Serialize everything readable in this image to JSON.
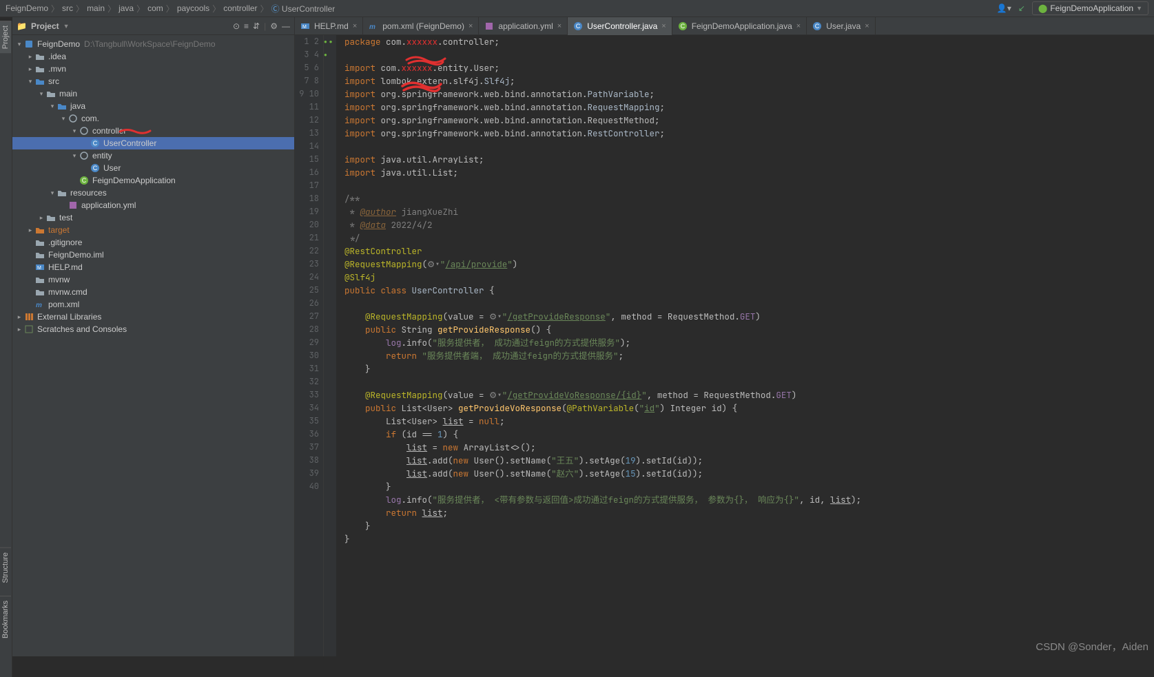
{
  "breadcrumb": [
    "FeignDemo",
    "src",
    "main",
    "java",
    "com",
    "paycools",
    "controller",
    "UserController"
  ],
  "run_config": "FeignDemoApplication",
  "project_label": "Project",
  "side_tabs": [
    "Project",
    "Bookmarks",
    "Structure"
  ],
  "tree": [
    {
      "depth": 0,
      "arrow": "▾",
      "icon": "module",
      "label": "FeignDemo",
      "hint": "D:\\Tangbull\\WorkSpace\\FeignDemo"
    },
    {
      "depth": 1,
      "arrow": "▸",
      "icon": "folder",
      "label": ".idea"
    },
    {
      "depth": 1,
      "arrow": "▸",
      "icon": "folder",
      "label": ".mvn"
    },
    {
      "depth": 1,
      "arrow": "▾",
      "icon": "folder-blue",
      "label": "src"
    },
    {
      "depth": 2,
      "arrow": "▾",
      "icon": "folder",
      "label": "main"
    },
    {
      "depth": 3,
      "arrow": "▾",
      "icon": "folder-blue",
      "label": "java"
    },
    {
      "depth": 4,
      "arrow": "▾",
      "icon": "package",
      "label": "com.",
      "red": true
    },
    {
      "depth": 5,
      "arrow": "▾",
      "icon": "package",
      "label": "controller"
    },
    {
      "depth": 6,
      "arrow": "",
      "icon": "class",
      "label": "UserController",
      "selected": true
    },
    {
      "depth": 5,
      "arrow": "▾",
      "icon": "package",
      "label": "entity"
    },
    {
      "depth": 6,
      "arrow": "",
      "icon": "class",
      "label": "User"
    },
    {
      "depth": 5,
      "arrow": "",
      "icon": "class-sb",
      "label": "FeignDemoApplication"
    },
    {
      "depth": 3,
      "arrow": "▾",
      "icon": "folder-res",
      "label": "resources"
    },
    {
      "depth": 4,
      "arrow": "",
      "icon": "yml",
      "label": "application.yml"
    },
    {
      "depth": 2,
      "arrow": "▸",
      "icon": "folder",
      "label": "test"
    },
    {
      "depth": 1,
      "arrow": "▸",
      "icon": "folder-orange",
      "label": "target",
      "orange": true
    },
    {
      "depth": 1,
      "arrow": "",
      "icon": "file",
      "label": ".gitignore"
    },
    {
      "depth": 1,
      "arrow": "",
      "icon": "file",
      "label": "FeignDemo.iml"
    },
    {
      "depth": 1,
      "arrow": "",
      "icon": "md",
      "label": "HELP.md"
    },
    {
      "depth": 1,
      "arrow": "",
      "icon": "file",
      "label": "mvnw"
    },
    {
      "depth": 1,
      "arrow": "",
      "icon": "file",
      "label": "mvnw.cmd"
    },
    {
      "depth": 1,
      "arrow": "",
      "icon": "maven",
      "label": "pom.xml"
    },
    {
      "depth": 0,
      "arrow": "▸",
      "icon": "lib",
      "label": "External Libraries"
    },
    {
      "depth": 0,
      "arrow": "▸",
      "icon": "scratch",
      "label": "Scratches and Consoles"
    }
  ],
  "tabs": [
    {
      "icon": "md",
      "label": "HELP.md"
    },
    {
      "icon": "maven",
      "label": "pom.xml (FeignDemo)"
    },
    {
      "icon": "yml",
      "label": "application.yml"
    },
    {
      "icon": "class",
      "label": "UserController.java",
      "active": true
    },
    {
      "icon": "class-sb",
      "label": "FeignDemoApplication.java"
    },
    {
      "icon": "class",
      "label": "User.java"
    }
  ],
  "line_count": 40,
  "watermark": "CSDN @Sonder，Aiden"
}
